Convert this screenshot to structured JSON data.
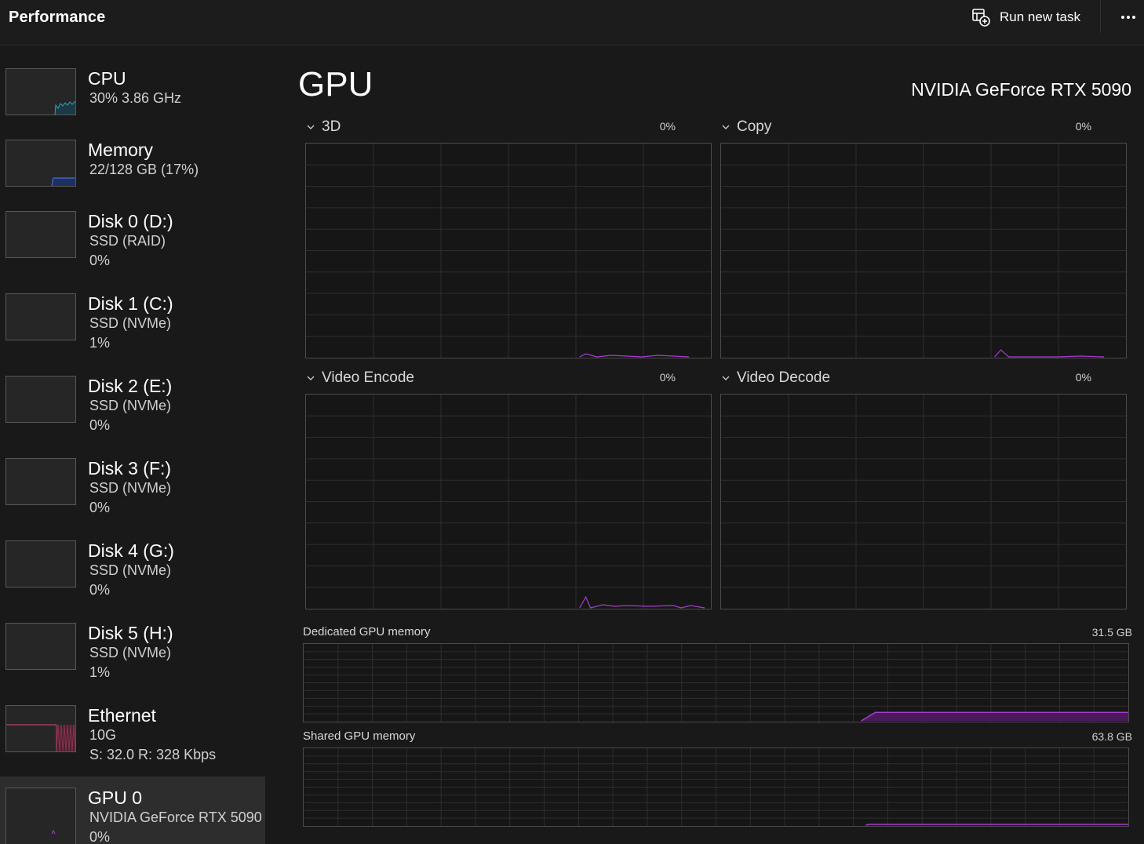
{
  "header": {
    "title": "Performance",
    "run_task_label": "Run new task",
    "run_task_icon": "run-task-icon",
    "more_icon": "more-icon"
  },
  "sidebar": {
    "items": [
      {
        "title": "CPU",
        "lines": [
          "30%  3.86 GHz"
        ],
        "graph_color": "#2aa3c0"
      },
      {
        "title": "Memory",
        "lines": [
          "22/128 GB (17%)"
        ],
        "graph_color": "#3e6fd0"
      },
      {
        "title": "Disk 0 (D:)",
        "lines": [
          "SSD (RAID)",
          "0%"
        ]
      },
      {
        "title": "Disk 1 (C:)",
        "lines": [
          "SSD (NVMe)",
          "1%"
        ]
      },
      {
        "title": "Disk 2 (E:)",
        "lines": [
          "SSD (NVMe)",
          "0%"
        ]
      },
      {
        "title": "Disk 3 (F:)",
        "lines": [
          "SSD (NVMe)",
          "0%"
        ]
      },
      {
        "title": "Disk 4 (G:)",
        "lines": [
          "SSD (NVMe)",
          "0%"
        ]
      },
      {
        "title": "Disk 5 (H:)",
        "lines": [
          "SSD (NVMe)",
          "1%"
        ]
      },
      {
        "title": "Ethernet",
        "lines": [
          "10G",
          "S: 32.0  R: 328 Kbps"
        ],
        "graph_color": "#d64d7a"
      },
      {
        "title": "GPU 0",
        "lines": [
          "NVIDIA GeForce RTX 5090",
          "0%"
        ],
        "selected": true,
        "graph_color": "#a63fcc"
      }
    ]
  },
  "main": {
    "heading": "GPU",
    "model": "NVIDIA GeForce RTX 5090",
    "engines": [
      {
        "label": "3D",
        "value": "0%"
      },
      {
        "label": "Copy",
        "value": "0%"
      },
      {
        "label": "Video Encode",
        "value": "0%"
      },
      {
        "label": "Video Decode",
        "value": "0%"
      }
    ],
    "memory": [
      {
        "label": "Dedicated GPU memory",
        "value": "31.5 GB"
      },
      {
        "label": "Shared GPU memory",
        "value": "63.8 GB"
      }
    ]
  },
  "colors": {
    "gpu_accent": "#a63fcc",
    "grid": "#2e2e2e"
  }
}
